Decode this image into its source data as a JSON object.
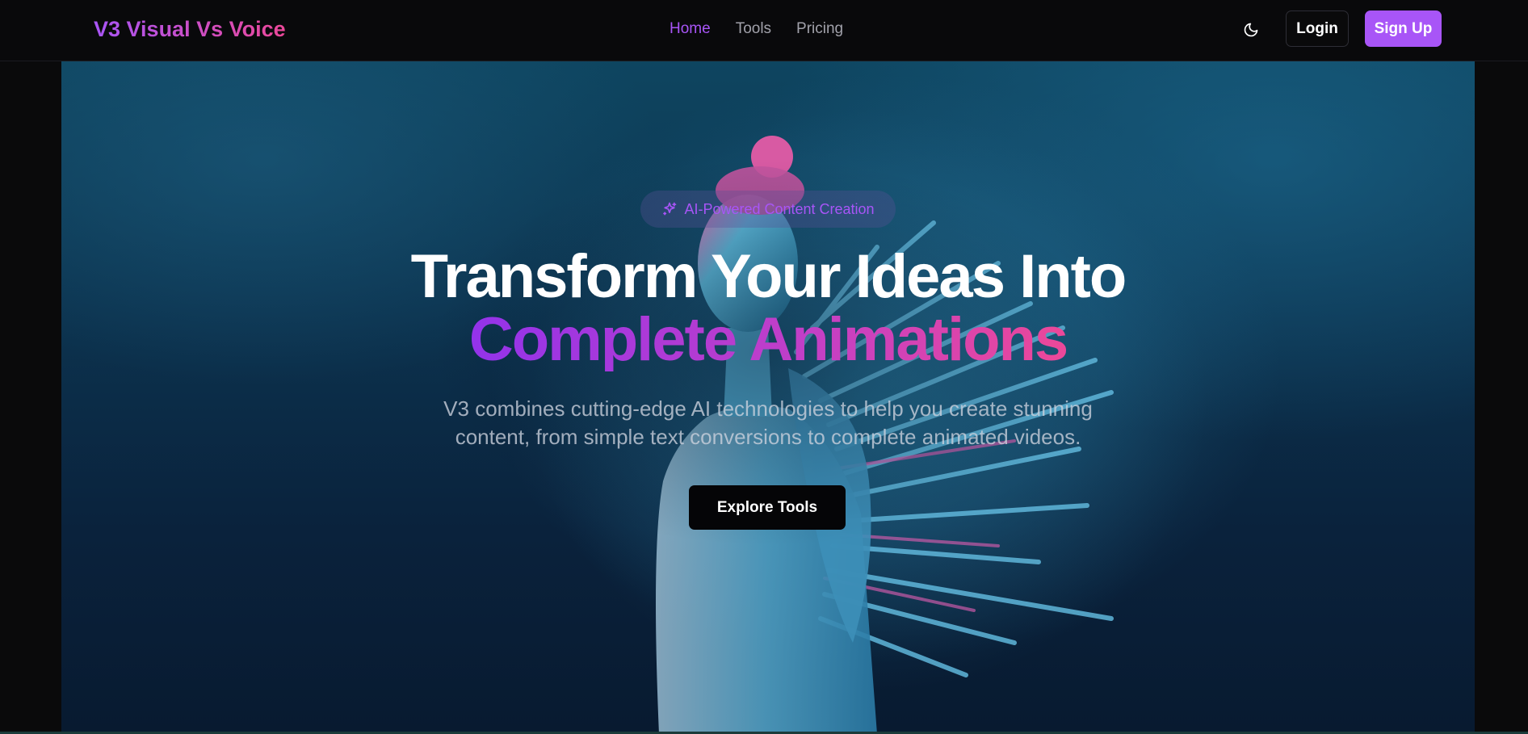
{
  "header": {
    "brand": "V3 Visual Vs Voice",
    "nav": [
      {
        "label": "Home",
        "active": true
      },
      {
        "label": "Tools",
        "active": false
      },
      {
        "label": "Pricing",
        "active": false
      }
    ],
    "theme_icon": "moon-icon",
    "login_label": "Login",
    "signup_label": "Sign Up"
  },
  "hero": {
    "badge_icon": "sparkles-icon",
    "badge_text": "AI-Powered Content Creation",
    "title_line1": "Transform Your Ideas Into",
    "title_line2": "Complete Animations",
    "subtitle": "V3 combines cutting-edge AI technologies to help you create stunning content, from simple text conversions to complete animated videos.",
    "cta_label": "Explore Tools",
    "background_image": "figure-with-spikes-art"
  },
  "colors": {
    "accent": "#a855f7",
    "accent_pink": "#ec4899",
    "background": "#09090b",
    "text": "#ffffff"
  }
}
